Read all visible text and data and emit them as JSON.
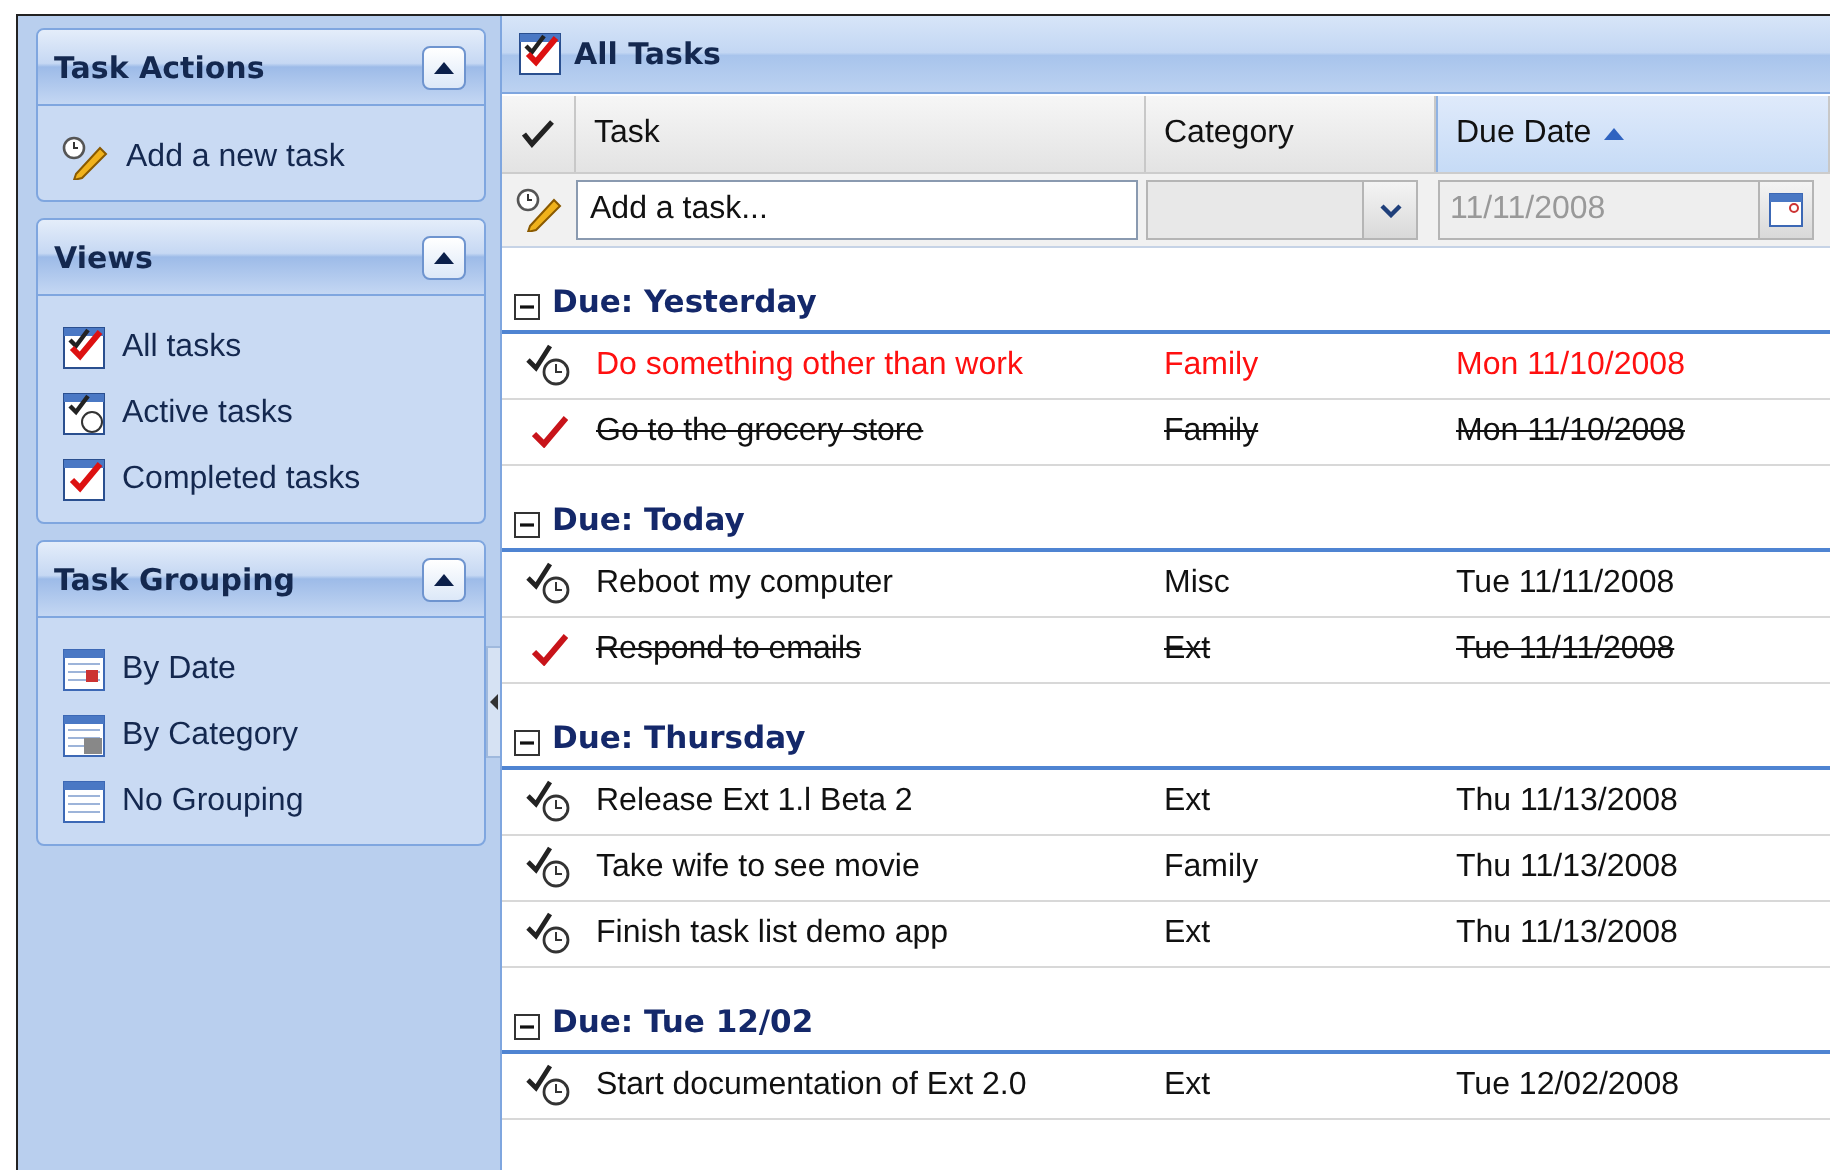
{
  "sidebar": {
    "panels": [
      {
        "title": "Task Actions",
        "expanded": true,
        "items": [
          {
            "label": "Add a new task",
            "kind": "add"
          }
        ]
      },
      {
        "title": "Views",
        "expanded": true,
        "items": [
          {
            "label": "All tasks",
            "kind": "all"
          },
          {
            "label": "Active tasks",
            "kind": "active"
          },
          {
            "label": "Completed tasks",
            "kind": "completed"
          }
        ]
      },
      {
        "title": "Task Grouping",
        "expanded": true,
        "items": [
          {
            "label": "By Date",
            "kind": "date"
          },
          {
            "label": "By Category",
            "kind": "category"
          },
          {
            "label": "No Grouping",
            "kind": "none"
          }
        ]
      }
    ]
  },
  "main": {
    "title": "All Tasks",
    "columns": [
      {
        "label": "Task",
        "sorted": false
      },
      {
        "label": "Category",
        "sorted": false
      },
      {
        "label": "Due Date",
        "sorted": true
      }
    ],
    "new_task": {
      "placeholder": "Add a task...",
      "date": "11/11/2008"
    },
    "groups": [
      {
        "title": "Due: Yesterday",
        "expanded": true,
        "rows": [
          {
            "task": "Do something other than work",
            "category": "Family",
            "due": "Mon 11/10/2008",
            "completed": false,
            "overdue": true
          },
          {
            "task": "Go to the grocery store",
            "category": "Family",
            "due": "Mon 11/10/2008",
            "completed": true,
            "overdue": false
          }
        ]
      },
      {
        "title": "Due: Today",
        "expanded": true,
        "rows": [
          {
            "task": "Reboot my computer",
            "category": "Misc",
            "due": "Tue 11/11/2008",
            "completed": false,
            "overdue": false
          },
          {
            "task": "Respond to emails",
            "category": "Ext",
            "due": "Tue 11/11/2008",
            "completed": true,
            "overdue": false
          }
        ]
      },
      {
        "title": "Due: Thursday",
        "expanded": true,
        "rows": [
          {
            "task": "Release Ext 1.l Beta 2",
            "category": "Ext",
            "due": "Thu 11/13/2008",
            "completed": false,
            "overdue": false
          },
          {
            "task": "Take wife to see movie",
            "category": "Family",
            "due": "Thu 11/13/2008",
            "completed": false,
            "overdue": false
          },
          {
            "task": "Finish task list demo app",
            "category": "Ext",
            "due": "Thu 11/13/2008",
            "completed": false,
            "overdue": false
          }
        ]
      },
      {
        "title": "Due: Tue 12/02",
        "expanded": true,
        "rows": [
          {
            "task": "Start documentation of Ext 2.0",
            "category": "Ext",
            "due": "Tue 12/02/2008",
            "completed": false,
            "overdue": false
          }
        ]
      }
    ]
  }
}
